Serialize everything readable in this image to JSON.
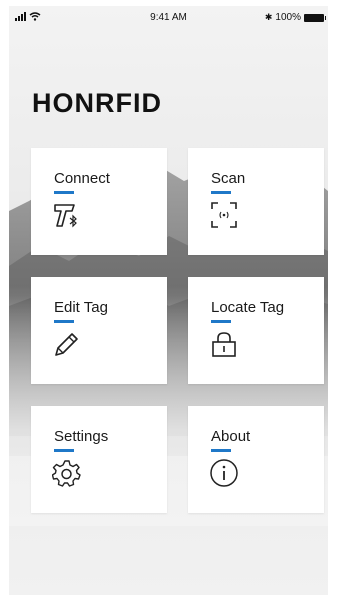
{
  "status_bar": {
    "time": "9:41 AM",
    "battery": "100%",
    "bluetooth_glyph": "✱"
  },
  "app": {
    "brand": "HONRFID"
  },
  "tiles": [
    {
      "label": "Connect",
      "icon": "scanner-bluetooth-icon"
    },
    {
      "label": "Scan",
      "icon": "scan-frame-icon"
    },
    {
      "label": "Edit Tag",
      "icon": "pencil-icon"
    },
    {
      "label": "Locate Tag",
      "icon": "lock-icon"
    },
    {
      "label": "Settings",
      "icon": "gear-icon"
    },
    {
      "label": "About",
      "icon": "info-icon"
    }
  ],
  "colors": {
    "accent": "#1f78c8",
    "tile_background": "#ffffff",
    "text": "#1a1a1a"
  }
}
